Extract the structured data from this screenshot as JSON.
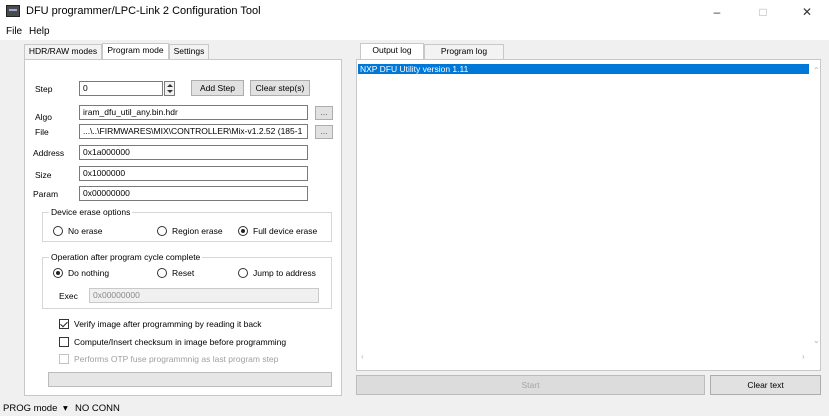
{
  "window": {
    "title": "DFU programmer/LPC-Link 2 Configuration Tool",
    "minimize": "–",
    "maximize": "□",
    "close": "✕"
  },
  "menu": {
    "file": "File",
    "help": "Help"
  },
  "left_tabs": [
    {
      "label": "HDR/RAW modes",
      "active": false
    },
    {
      "label": "Program mode",
      "active": true
    },
    {
      "label": "Settings",
      "active": false
    }
  ],
  "program": {
    "step_label": "Step",
    "step_value": "0",
    "add_step": "Add Step",
    "clear_steps": "Clear step(s)",
    "algo_label": "Algo",
    "algo_value": "iram_dfu_util_any.bin.hdr",
    "file_label": "File",
    "file_value": "...\\..\\FIRMWARES\\MIX\\CONTROLLER\\Mix-v1.2.52 (185-1",
    "browse": "...",
    "address_label": "Address",
    "address_value": "0x1a000000",
    "size_label": "Size",
    "size_value": "0x1000000",
    "param_label": "Param",
    "param_value": "0x00000000"
  },
  "erase": {
    "title": "Device erase options",
    "options": [
      "No erase",
      "Region erase",
      "Full device erase"
    ],
    "selected": "Full device erase"
  },
  "after": {
    "title": "Operation after program cycle complete",
    "options": [
      "Do nothing",
      "Reset",
      "Jump to address"
    ],
    "selected": "Do nothing",
    "exec_label": "Exec",
    "exec_value": "0x00000000"
  },
  "checks": {
    "verify": "Verify image after programming by reading it back",
    "verify_checked": true,
    "checksum": "Compute/Insert checksum in image before programming",
    "checksum_checked": false,
    "otp": "Performs OTP fuse programmnig as last program step",
    "otp_checked": false
  },
  "right_tabs": [
    {
      "label": "Output log",
      "active": true
    },
    {
      "label": "Program log",
      "active": false
    }
  ],
  "log": {
    "lines": [
      "NXP DFU Utility version 1.11"
    ]
  },
  "actions": {
    "start": "Start",
    "clear_text": "Clear text"
  },
  "status": {
    "mode": "PROG mode",
    "arrow": "▾",
    "conn": "NO CONN"
  },
  "colors": {
    "selection": "#0078d7",
    "window_bg": "#f0f0f0"
  }
}
